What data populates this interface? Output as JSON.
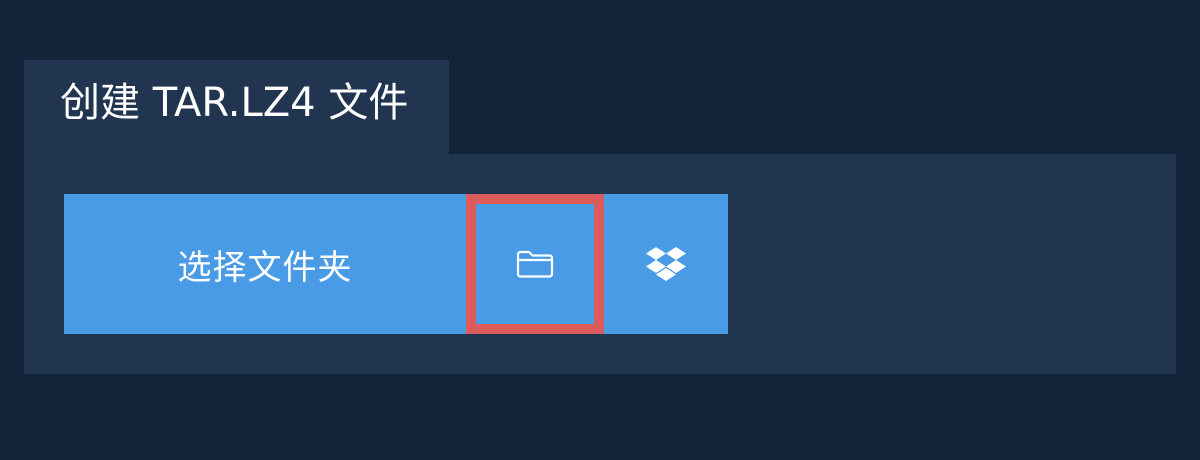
{
  "tab": {
    "title": "创建 TAR.LZ4 文件"
  },
  "buttons": {
    "choose_folder_label": "选择文件夹",
    "local_folder_icon": "folder-icon",
    "dropbox_icon": "dropbox-icon"
  },
  "colors": {
    "page_background": "#11243a",
    "panel_background": "#213550",
    "button_background": "#4a9be6",
    "highlight_border": "#dc5a5a",
    "text": "#ffffff"
  }
}
